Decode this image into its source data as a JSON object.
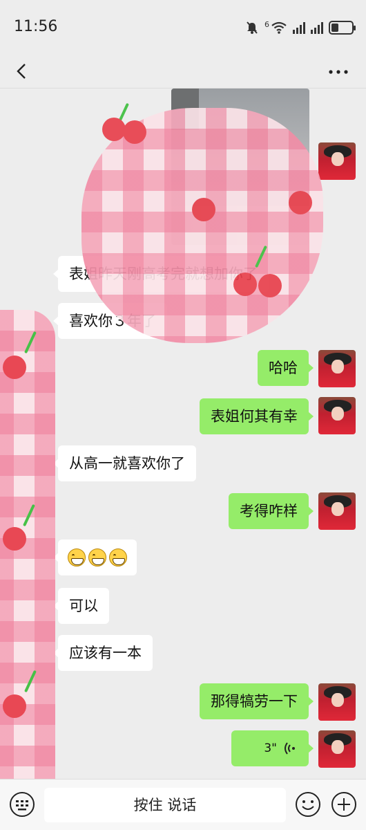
{
  "status_bar": {
    "time": "11:56",
    "network_label": "6"
  },
  "nav": {
    "back_icon": "chevron-left-icon",
    "more_icon": "more-dots-icon"
  },
  "messages": [
    {
      "side": "right",
      "type": "image"
    },
    {
      "side": "left",
      "type": "text",
      "text": "表姐昨天刚高考完就想加你了"
    },
    {
      "side": "left",
      "type": "text",
      "text": "喜欢你３年了"
    },
    {
      "side": "right",
      "type": "text",
      "text": "哈哈"
    },
    {
      "side": "right",
      "type": "text",
      "text": "表姐何其有幸"
    },
    {
      "side": "left",
      "type": "text",
      "text": "从高一就喜欢你了"
    },
    {
      "side": "right",
      "type": "text",
      "text": "考得咋样"
    },
    {
      "side": "left",
      "type": "emoji",
      "emoji": "grinning-face",
      "count": 3
    },
    {
      "side": "left",
      "type": "text",
      "text": "可以"
    },
    {
      "side": "left",
      "type": "text",
      "text": "应该有一本"
    },
    {
      "side": "right",
      "type": "text",
      "text": "那得犒劳一下"
    },
    {
      "side": "right",
      "type": "voice",
      "duration": "3\""
    }
  ],
  "input_bar": {
    "keyboard_icon": "keyboard-icon",
    "hold_to_talk": "按住 说话",
    "emoji_icon": "smile-icon",
    "plus_icon": "plus-circle-icon"
  },
  "colors": {
    "background": "#ededed",
    "sent_bubble": "#95ec69",
    "received_bubble": "#ffffff",
    "input_bar": "#f7f7f7"
  }
}
